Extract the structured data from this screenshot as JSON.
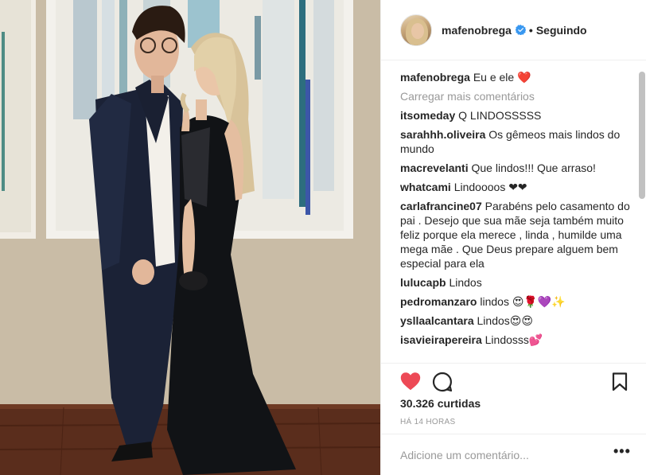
{
  "post": {
    "image_alt": "Foto de um casal posando em frente a um quadro",
    "username": "mafenobrega",
    "separator": "•",
    "follow_status": "Seguindo",
    "caption": {
      "user": "mafenobrega",
      "text": "Eu e ele ❤️"
    },
    "load_more": "Carregar mais comentários",
    "comments": [
      {
        "user": "itsomeday",
        "text": "Q LINDOSSSSS"
      },
      {
        "user": "sarahhh.oliveira",
        "text": "Os gêmeos mais lindos do mundo"
      },
      {
        "user": "macrevelanti",
        "text": "Que lindos!!! Que arraso!"
      },
      {
        "user": "whatcami",
        "text": "Lindoooos ❤❤"
      },
      {
        "user": "carlafrancine07",
        "text": "Parabéns pelo casamento do pai . Desejo que sua mãe seja também muito feliz porque ela merece , linda , humilde uma mega mãe . Que Deus prepare alguem bem especial para ela"
      },
      {
        "user": "lulucapb",
        "text": "Lindos"
      },
      {
        "user": "pedromanzaro",
        "text": "lindos 😍🌹💜✨"
      },
      {
        "user": "ysllaalcantara",
        "text": "Lindos😍😍"
      },
      {
        "user": "isavieirapereira",
        "text": "Lindosss💕"
      }
    ],
    "likes": "30.326 curtidas",
    "time": "HÁ 14 HORAS",
    "add_comment_placeholder": "Adicione um comentário...",
    "more_label": "•••",
    "liked": true,
    "colors": {
      "heart": "#ed4956",
      "verified": "#3897f0",
      "muted": "#999999"
    }
  }
}
